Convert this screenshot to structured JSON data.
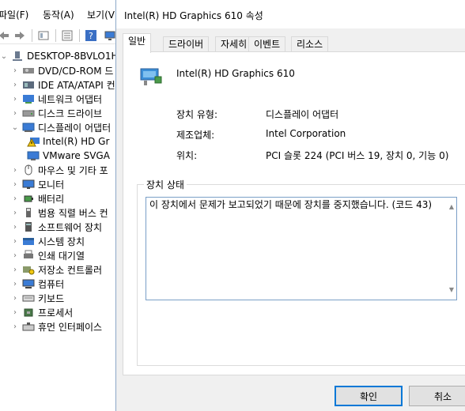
{
  "menu": {
    "file": "파일(F)",
    "action": "동작(A)",
    "view": "보기(V"
  },
  "tree": {
    "root": "DESKTOP-8BVLO1H",
    "items": [
      {
        "label": "DVD/CD-ROM 드",
        "icon": "dvd-drive-icon"
      },
      {
        "label": "IDE ATA/ATAPI 컨",
        "icon": "ide-controller-icon"
      },
      {
        "label": "네트워크 어댑터",
        "icon": "network-adapter-icon"
      },
      {
        "label": "디스크 드라이브",
        "icon": "disk-drive-icon"
      },
      {
        "label": "디스플레이 어댑터",
        "icon": "display-adapter-icon"
      },
      {
        "label": "Intel(R) HD Gr",
        "icon": "warning-display-icon"
      },
      {
        "label": "VMware SVGA",
        "icon": "display-device-icon"
      },
      {
        "label": "마우스 및 기타 포",
        "icon": "mouse-icon"
      },
      {
        "label": "모니터",
        "icon": "monitor-icon"
      },
      {
        "label": "배터리",
        "icon": "battery-icon"
      },
      {
        "label": "범용 직렬 버스 컨",
        "icon": "usb-icon"
      },
      {
        "label": "소프트웨어 장치",
        "icon": "software-device-icon"
      },
      {
        "label": "시스템 장치",
        "icon": "system-device-icon"
      },
      {
        "label": "인쇄 대기열",
        "icon": "printer-icon"
      },
      {
        "label": "저장소 컨트롤러",
        "icon": "storage-controller-icon"
      },
      {
        "label": "컴퓨터",
        "icon": "computer-icon"
      },
      {
        "label": "키보드",
        "icon": "keyboard-icon"
      },
      {
        "label": "프로세서",
        "icon": "processor-icon"
      },
      {
        "label": "휴먼 인터페이스",
        "icon": "hid-icon"
      }
    ]
  },
  "dialog": {
    "title": "Intel(R) HD Graphics 610 속성",
    "tabs": [
      "일반",
      "드라이버",
      "자세히",
      "이벤트",
      "리소스"
    ],
    "device_name": "Intel(R) HD Graphics 610",
    "props": [
      {
        "label": "장치 유형:",
        "value": "디스플레이 어댑터"
      },
      {
        "label": "제조업체:",
        "value": "Intel Corporation"
      },
      {
        "label": "위치:",
        "value": "PCI 슬롯 224 (PCI 버스 19, 장치 0, 기능 0)"
      }
    ],
    "status_legend": "장치 상태",
    "status_text": "이 장치에서 문제가 보고되었기 때문에 장치를 중지했습니다. (코드 43)",
    "ok_label": "확인",
    "cancel_label": "취소"
  },
  "colors": {
    "accent": "#0078d7",
    "warning": "#f2c811"
  }
}
